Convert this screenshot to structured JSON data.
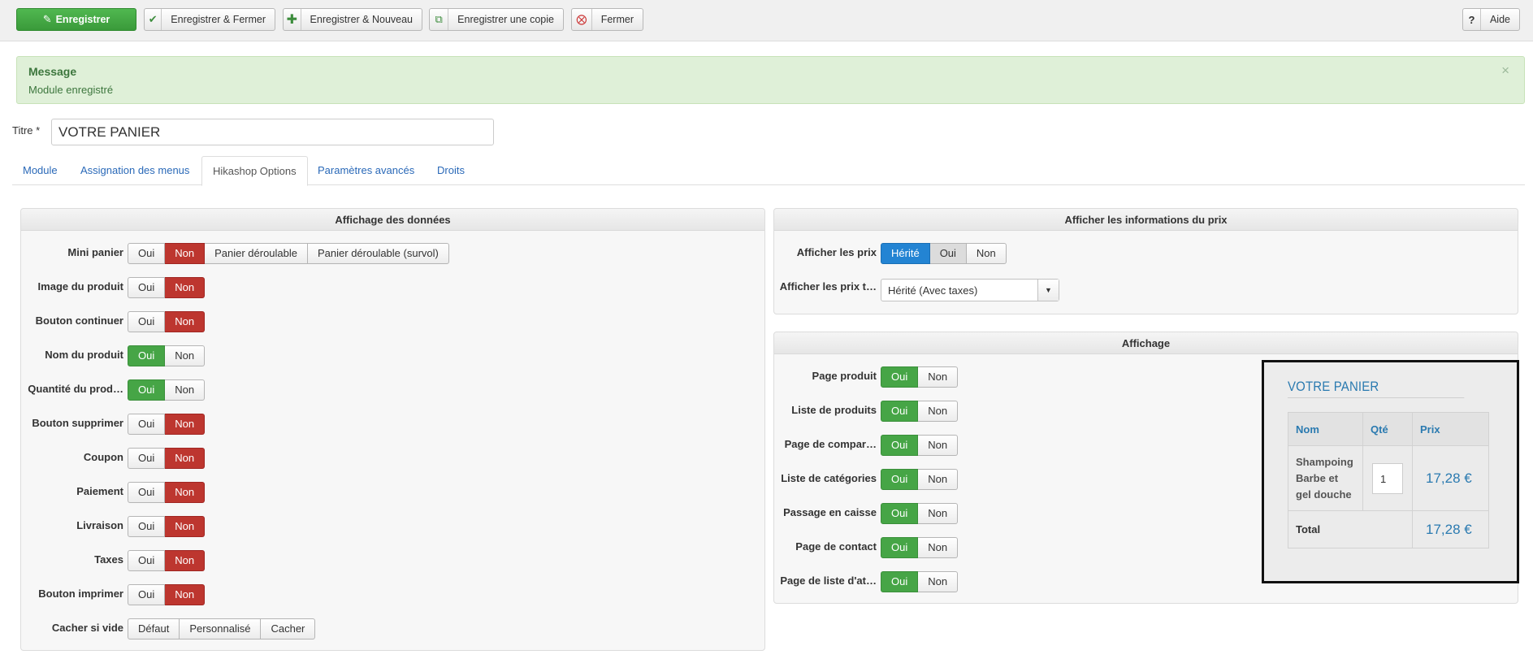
{
  "toolbar": {
    "save": "Enregistrer",
    "save_close": "Enregistrer & Fermer",
    "save_new": "Enregistrer & Nouveau",
    "save_copy": "Enregistrer une copie",
    "close": "Fermer",
    "help": "Aide",
    "icons": {
      "save": "edit-icon",
      "save_close": "check-icon",
      "save_new": "plus-icon",
      "save_copy": "copy-icon",
      "close": "close-circle-icon",
      "help": "question-icon"
    }
  },
  "message": {
    "title": "Message",
    "text": "Module enregistré",
    "close": "×"
  },
  "title_field": {
    "label": "Titre *",
    "value": "VOTRE PANIER"
  },
  "tabs": [
    "Module",
    "Assignation des menus",
    "Hikashop Options",
    "Paramètres avancés",
    "Droits"
  ],
  "active_tab": "Hikashop Options",
  "panel_data": {
    "title": "Affichage des données",
    "rows": [
      {
        "label": "Mini panier",
        "options": [
          "Oui",
          "Non",
          "Panier déroulable",
          "Panier déroulable (survol)"
        ],
        "selected": "Non"
      },
      {
        "label": "Image du produit",
        "options": [
          "Oui",
          "Non"
        ],
        "selected": "Non"
      },
      {
        "label": "Bouton continuer",
        "options": [
          "Oui",
          "Non"
        ],
        "selected": "Non"
      },
      {
        "label": "Nom du produit",
        "options": [
          "Oui",
          "Non"
        ],
        "selected": "Oui"
      },
      {
        "label": "Quantité du prod…",
        "options": [
          "Oui",
          "Non"
        ],
        "selected": "Oui"
      },
      {
        "label": "Bouton supprimer",
        "options": [
          "Oui",
          "Non"
        ],
        "selected": "Non"
      },
      {
        "label": "Coupon",
        "options": [
          "Oui",
          "Non"
        ],
        "selected": "Non"
      },
      {
        "label": "Paiement",
        "options": [
          "Oui",
          "Non"
        ],
        "selected": "Non"
      },
      {
        "label": "Livraison",
        "options": [
          "Oui",
          "Non"
        ],
        "selected": "Non"
      },
      {
        "label": "Taxes",
        "options": [
          "Oui",
          "Non"
        ],
        "selected": "Non"
      },
      {
        "label": "Bouton imprimer",
        "options": [
          "Oui",
          "Non"
        ],
        "selected": "Non"
      },
      {
        "label": "Cacher si vide",
        "options": [
          "Défaut",
          "Personnalisé",
          "Cacher"
        ],
        "selected": null
      }
    ]
  },
  "panel_price": {
    "title": "Afficher les informations du prix",
    "show_prices": {
      "label": "Afficher les prix",
      "options": [
        "Hérité",
        "Oui",
        "Non"
      ],
      "selected": "Hérité"
    },
    "price_type": {
      "label": "Afficher les prix t…",
      "value": "Hérité (Avec taxes)"
    }
  },
  "panel_display": {
    "title": "Affichage",
    "rows": [
      {
        "label": "Page produit",
        "options": [
          "Oui",
          "Non"
        ],
        "selected": "Oui"
      },
      {
        "label": "Liste de produits",
        "options": [
          "Oui",
          "Non"
        ],
        "selected": "Oui"
      },
      {
        "label": "Page de compar…",
        "options": [
          "Oui",
          "Non"
        ],
        "selected": "Oui"
      },
      {
        "label": "Liste de catégories",
        "options": [
          "Oui",
          "Non"
        ],
        "selected": "Oui"
      },
      {
        "label": "Passage en caisse",
        "options": [
          "Oui",
          "Non"
        ],
        "selected": "Oui"
      },
      {
        "label": "Page de contact",
        "options": [
          "Oui",
          "Non"
        ],
        "selected": "Oui"
      },
      {
        "label": "Page de liste d'at…",
        "options": [
          "Oui",
          "Non"
        ],
        "selected": "Oui"
      }
    ]
  },
  "preview": {
    "title": "VOTRE PANIER",
    "headers": [
      "Nom",
      "Qté",
      "Prix"
    ],
    "item": {
      "name": "Shampoing Barbe et gel douche",
      "qty": "1",
      "price": "17,28 €"
    },
    "total_label": "Total",
    "total_value": "17,28 €"
  },
  "colors": {
    "selected_no": "#bd362f",
    "selected_yes": "#46a546",
    "selected_inherited": "#2384d3",
    "link": "#2a69b8",
    "message_bg": "#dff0d8"
  }
}
